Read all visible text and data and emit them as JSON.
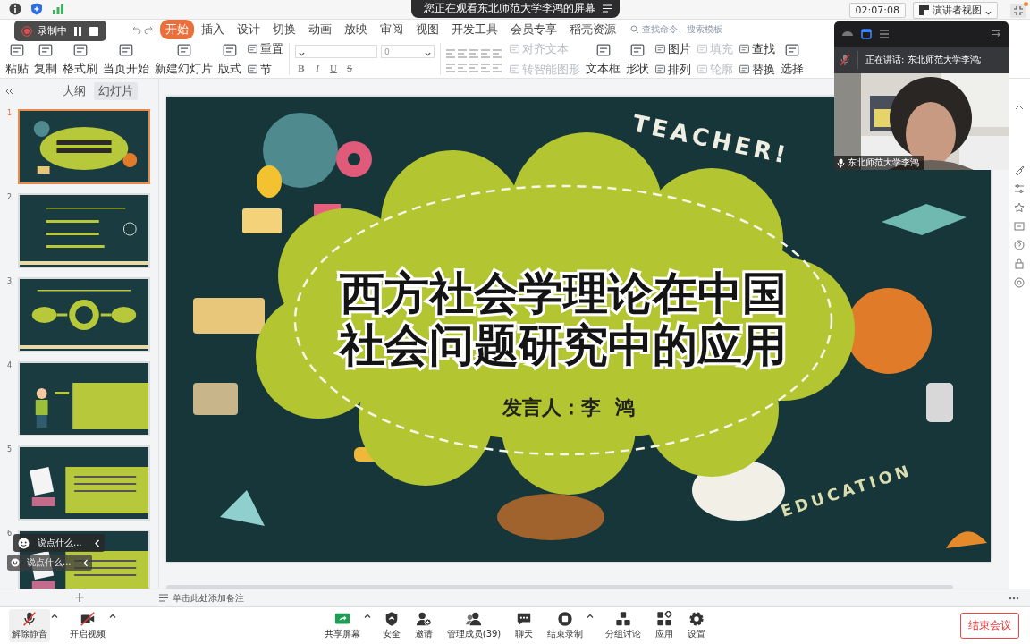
{
  "topbar": {
    "banner": "您正在观看东北师范大学李鸿的屏幕",
    "time": "02:07:08",
    "view_menu": "演讲者视图"
  },
  "recording": {
    "label": "录制中"
  },
  "ribbon": {
    "tabs": [
      {
        "label": "开始",
        "selected": true
      },
      {
        "label": "插入",
        "selected": false
      },
      {
        "label": "设计",
        "selected": false
      },
      {
        "label": "切换",
        "selected": false
      },
      {
        "label": "动画",
        "selected": false
      },
      {
        "label": "放映",
        "selected": false
      },
      {
        "label": "审阅",
        "selected": false
      },
      {
        "label": "视图",
        "selected": false
      },
      {
        "label": "开发工具",
        "selected": false
      },
      {
        "label": "会员专享",
        "selected": false
      },
      {
        "label": "稻壳资源",
        "selected": false
      }
    ],
    "search": {
      "placeholder": "查找命令、搜索模板"
    },
    "tools_left": [
      {
        "kind": "large",
        "label": "粘贴"
      },
      {
        "kind": "large",
        "label": "复制"
      },
      {
        "kind": "large",
        "label": "格式刷"
      },
      {
        "kind": "large",
        "label": "当页开始"
      },
      {
        "kind": "large",
        "label": "新建幻灯片"
      },
      {
        "kind": "large",
        "label": "版式"
      },
      {
        "kind": "pair",
        "items": [
          {
            "label": "重置",
            "disabled": false
          },
          {
            "label": "节",
            "disabled": false
          }
        ]
      }
    ],
    "font_size": "0",
    "format_buttons": [
      "B",
      "I",
      "U",
      "S"
    ],
    "tools_right": [
      {
        "kind": "pair",
        "items": [
          {
            "label": "对齐文本",
            "disabled": true
          },
          {
            "label": "转智能图形",
            "disabled": true
          }
        ]
      },
      {
        "kind": "large",
        "label": "文本框"
      },
      {
        "kind": "large",
        "label": "形状"
      },
      {
        "kind": "pair",
        "items": [
          {
            "label": "图片",
            "disabled": false
          },
          {
            "label": "排列",
            "disabled": false
          }
        ]
      },
      {
        "kind": "pair",
        "items": [
          {
            "label": "填充",
            "disabled": true
          },
          {
            "label": "轮廓",
            "disabled": true
          }
        ]
      },
      {
        "kind": "pair",
        "items": [
          {
            "label": "查找",
            "disabled": false
          },
          {
            "label": "替换",
            "disabled": false
          }
        ]
      },
      {
        "kind": "large",
        "label": "选择"
      }
    ]
  },
  "slides": {
    "tabs": [
      {
        "label": "大纲",
        "selected": false
      },
      {
        "label": "幻灯片",
        "selected": true
      }
    ],
    "slides": [
      {
        "number": "1",
        "kind": "title",
        "selected": true
      },
      {
        "number": "2",
        "kind": "questions",
        "selected": false
      },
      {
        "number": "3",
        "kind": "diagram",
        "selected": false
      },
      {
        "number": "4",
        "kind": "figure",
        "selected": false
      },
      {
        "number": "5",
        "kind": "document",
        "selected": false
      },
      {
        "number": "6",
        "kind": "document",
        "selected": false
      }
    ]
  },
  "chat_bubbles": [
    "说点什么...",
    "说点什么..."
  ],
  "slide": {
    "title_lines": [
      "西方社会学理论在中国",
      "社会问题研究中的应用"
    ],
    "speaker": "发言人：李  鸿",
    "doodle_words": [
      "TEACHER!",
      "EDUCATION"
    ]
  },
  "video": {
    "speaking": "正在讲话: 东北师范大学李鸿;",
    "name": "东北师范大学李鸿",
    "muted": true
  },
  "notes": {
    "add_slide": "+",
    "placeholder": "单击此处添加备注"
  },
  "toolbar": {
    "left": [
      {
        "kind": "mic",
        "label": "解除静音",
        "caret": true
      },
      {
        "kind": "camera",
        "label": "开启视频",
        "caret": true
      }
    ],
    "center": [
      {
        "kind": "share",
        "label": "共享屏幕",
        "caret": true
      },
      {
        "kind": "security",
        "label": "安全",
        "caret": false
      },
      {
        "kind": "invite",
        "label": "邀请",
        "caret": false
      },
      {
        "kind": "members",
        "label": "管理成员(39)",
        "caret": false
      },
      {
        "kind": "chat",
        "label": "聊天",
        "caret": false
      },
      {
        "kind": "record",
        "label": "结束录制",
        "caret": true
      },
      {
        "kind": "breakout",
        "label": "分组讨论",
        "caret": false
      },
      {
        "kind": "apps",
        "label": "应用",
        "caret": false
      },
      {
        "kind": "settings",
        "label": "设置",
        "caret": false
      }
    ],
    "end_button": "结束会议"
  }
}
